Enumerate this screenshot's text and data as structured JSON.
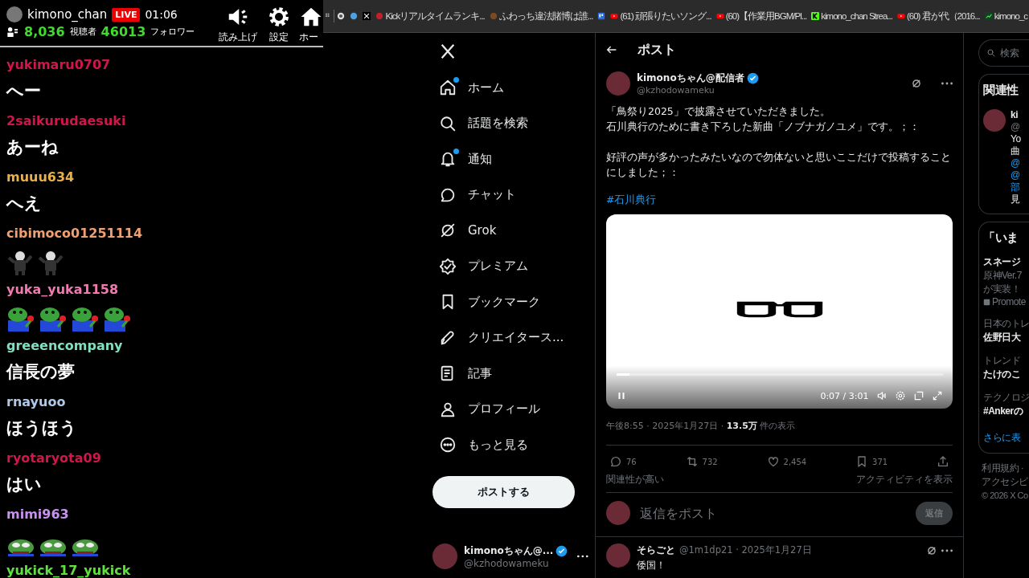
{
  "chat": {
    "header": {
      "channel": "kimono_chan",
      "live_badge": "LIVE",
      "elapsed": "01:06",
      "viewers": "8,036",
      "viewers_label": "視聴者",
      "followers": "46013",
      "followers_label": "フォロワー",
      "buttons": [
        "読み上げ",
        "設定",
        "ホー"
      ]
    },
    "messages": [
      {
        "user": "yukimaru0707",
        "color": "#d0174a",
        "kind": "text",
        "text": "へー"
      },
      {
        "user": "2saikurudaesuki",
        "color": "#d0174a",
        "kind": "text",
        "text": "あーね"
      },
      {
        "user": "muuu634",
        "color": "#e8b04a",
        "kind": "text",
        "text": "へえ"
      },
      {
        "user": "cibimoco01251114",
        "color": "#f0a070",
        "kind": "emotes",
        "emotes": [
          {
            "kind": "figure"
          },
          {
            "kind": "figure"
          }
        ]
      },
      {
        "user": "yuka_yuka1158",
        "color": "#f07ab0",
        "kind": "emotes",
        "emotes": [
          {
            "kind": "frog"
          },
          {
            "kind": "frog"
          },
          {
            "kind": "frog"
          },
          {
            "kind": "frog"
          }
        ]
      },
      {
        "user": "greeencompany",
        "color": "#7fe0c0",
        "kind": "text",
        "text": "信長の夢"
      },
      {
        "user": "rnayuoo",
        "color": "#b0c8e8",
        "kind": "text",
        "text": "ほうほう"
      },
      {
        "user": "ryotaryota09",
        "color": "#d0174a",
        "kind": "text",
        "text": "はい"
      },
      {
        "user": "mimi963",
        "color": "#c890f0",
        "kind": "emotes",
        "emotes": [
          {
            "kind": "pepe"
          },
          {
            "kind": "pepe"
          },
          {
            "kind": "pepe"
          }
        ]
      },
      {
        "user": "yukick_17_yukick",
        "color": "#60e040",
        "kind": "text"
      }
    ]
  },
  "bookmarks": [
    {
      "kind": "icon"
    },
    {
      "kind": "icon"
    },
    {
      "kind": "icon"
    },
    {
      "kind": "link",
      "label": "Kickリアルタイムランキ..."
    },
    {
      "kind": "link",
      "label": "ふわっち違法賭博は誰..."
    },
    {
      "kind": "icon"
    },
    {
      "kind": "link",
      "label": "(61) 頑張りたいソング..."
    },
    {
      "kind": "link",
      "label": "(60)【作業用BGM/Pl..."
    },
    {
      "kind": "link",
      "label": "kimono_chan Strea..."
    },
    {
      "kind": "link",
      "label": "(60) 君が代（2016..."
    },
    {
      "kind": "link",
      "label": "kimono_c"
    }
  ],
  "nav": {
    "items": [
      {
        "label": "ホーム",
        "dot": true
      },
      {
        "label": "話題を検索",
        "dot": false
      },
      {
        "label": "通知",
        "dot": true
      },
      {
        "label": "チャット",
        "dot": false
      },
      {
        "label": "Grok",
        "dot": false
      },
      {
        "label": "プレミアム",
        "dot": false
      },
      {
        "label": "ブックマーク",
        "dot": false
      },
      {
        "label": "クリエイタース...",
        "dot": false
      },
      {
        "label": "記事",
        "dot": false
      },
      {
        "label": "プロフィール",
        "dot": false
      },
      {
        "label": "もっと見る",
        "dot": false
      }
    ],
    "post_button": "ポストする",
    "account": {
      "name": "kimonoちゃん@...",
      "handle": "@kzhodowameku",
      "verified": true
    }
  },
  "post": {
    "header_title": "ポスト",
    "author": {
      "name": "kimonoちゃん@配信者",
      "handle": "@kzhodowameku",
      "verified": true
    },
    "paragraphs": [
      {
        "lines": [
          "「鳥祭り2025」で披露させていただきました。",
          "石川典行のために書き下ろした新曲「ノブナガノユメ」です。；："
        ]
      },
      {
        "lines": [
          "好評の声が多かったみたいなので勿体ないと思いここだけで投稿することにしました；："
        ]
      }
    ],
    "hashtag": "#石川典行",
    "video": {
      "time": "0:07 / 3:01",
      "playing": true,
      "level": 0.04
    },
    "meta": "午後8:55 · 2025年1月27日 · **13.5万** 件の表示",
    "actions": [
      {
        "count": "76"
      },
      {
        "count": "732"
      },
      {
        "count": "2,454"
      },
      {
        "count": "371"
      }
    ],
    "sort": "関連性が高い",
    "activity": "アクティビティを表示",
    "reply": {
      "placeholder": "返信をポスト",
      "button": "返信",
      "disabled": true
    },
    "replies": [
      {
        "name": "そらごと",
        "meta": "@1m1dp21 · 2025年1月27日",
        "text": "倭国！"
      }
    ]
  },
  "sidebar": {
    "search": {
      "placeholder": "検索"
    },
    "related": {
      "title": "関連性",
      "name": "ki",
      "handle": "@",
      "lines": [
        {
          "text": "Yo",
          "link": false
        },
        {
          "text": "曲",
          "link": false
        },
        {
          "text": "@",
          "link": true
        },
        {
          "text": "@",
          "link": true
        },
        {
          "text": "部",
          "link": true
        },
        {
          "text": "見",
          "link": false
        }
      ]
    },
    "trends": {
      "title": "「いま",
      "items": [
        {
          "title": "スネージ",
          "lines": [
            "原神Ver.7",
            "が実装！"
          ],
          "promoted": "Promote"
        },
        {
          "category": "日本のトレ",
          "title": "佐野日大"
        },
        {
          "category": "トレンド",
          "title": "たけのこ"
        },
        {
          "category": "テクノロジ",
          "title": "#Ankerの"
        }
      ],
      "more": "さらに表"
    },
    "footer": [
      "利用規約 ·",
      "アクセシビ",
      "© 2026 X Co"
    ]
  }
}
